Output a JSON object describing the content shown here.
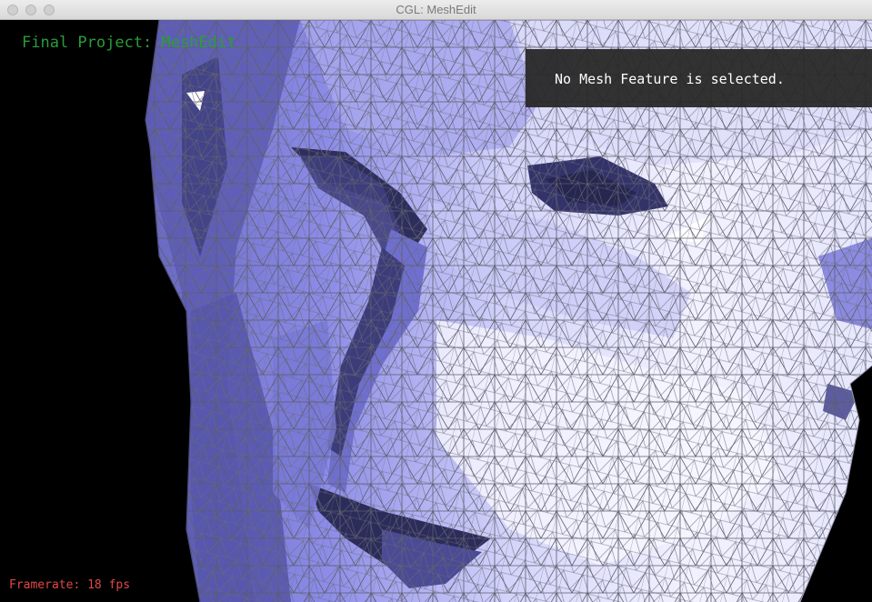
{
  "window": {
    "title": "CGL: MeshEdit",
    "buttons": [
      "close",
      "minimize",
      "maximize"
    ]
  },
  "overlay": {
    "project_label": "Final Project: MeshEdit",
    "info_text": "No Mesh Feature is selected.",
    "framerate": "Framerate: 18 fps"
  },
  "colors": {
    "background": "#000000",
    "project_label": "#2a9d3a",
    "framerate": "#e04848",
    "info_panel": "#282828",
    "mesh_light": "#f4f4ff",
    "mesh_mid": "#9a9af0",
    "mesh_dark": "#2c2c54",
    "mesh_edges": "#555566"
  },
  "scene": {
    "object": "triangle mesh head",
    "icon": "mesh-viewport"
  }
}
